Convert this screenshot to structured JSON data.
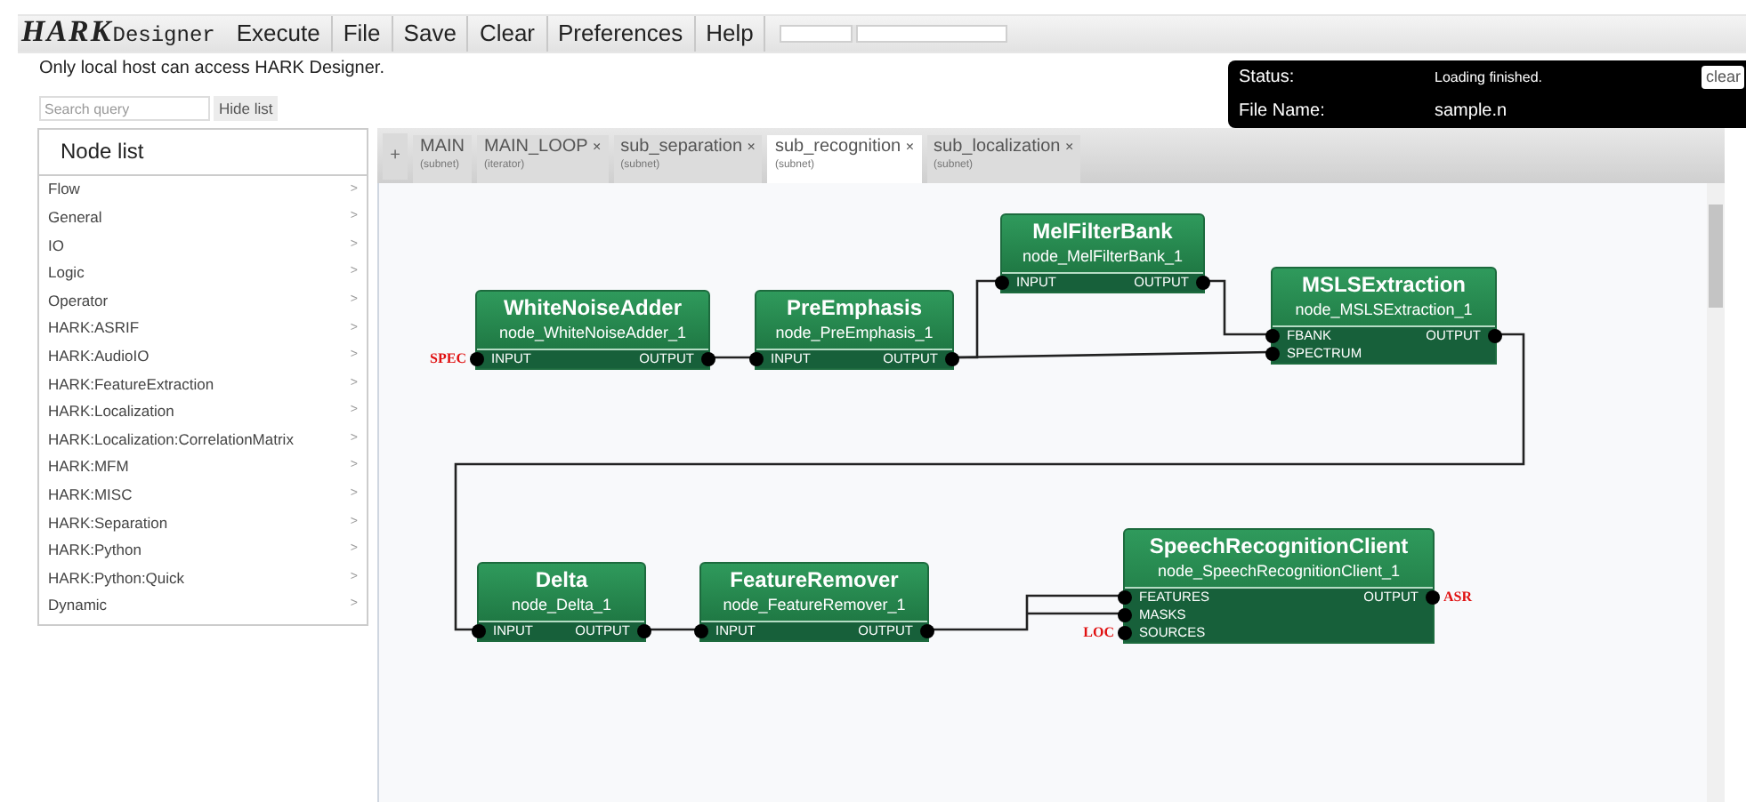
{
  "menu": {
    "logo": "HARK",
    "logo_suffix": "Designer",
    "items": [
      "Execute",
      "File",
      "Save",
      "Clear",
      "Preferences",
      "Help"
    ],
    "slider": {
      "level": 0.31
    }
  },
  "notice": "Only local host can access HARK Designer.",
  "status_panel": {
    "status_label": "Status:",
    "status": "Loading finished.",
    "clear": "clear",
    "file_label": "File Name:",
    "file": "sample.n"
  },
  "search": {
    "placeholder": "Search query",
    "hide_button": "Hide list"
  },
  "node_list": {
    "title": "Node list",
    "items": [
      {
        "label": "Flow",
        "arrow": ">"
      },
      {
        "label": "General",
        "arrow": ">"
      },
      {
        "label": "IO",
        "arrow": ">"
      },
      {
        "label": "Logic",
        "arrow": ">"
      },
      {
        "label": "Operator",
        "arrow": ">"
      },
      {
        "label": "HARK:ASRIF",
        "arrow": ">"
      },
      {
        "label": "HARK:AudioIO",
        "arrow": ">"
      },
      {
        "label": "HARK:FeatureExtraction",
        "arrow": ">"
      },
      {
        "label": "HARK:Localization",
        "arrow": ">"
      },
      {
        "label": "HARK:Localization:CorrelationMatrix",
        "arrow": ">"
      },
      {
        "label": "HARK:MFM",
        "arrow": ">"
      },
      {
        "label": "HARK:MISC",
        "arrow": ">"
      },
      {
        "label": "HARK:Separation",
        "arrow": ">"
      },
      {
        "label": "HARK:Python",
        "arrow": ">"
      },
      {
        "label": "HARK:Python:Quick",
        "arrow": ">"
      },
      {
        "label": "Dynamic",
        "arrow": ">"
      }
    ]
  },
  "tabs": {
    "add": "+",
    "items": [
      {
        "label": "MAIN",
        "sub": "(subnet)",
        "selected": false
      },
      {
        "label": "MAIN_LOOP",
        "sub": "(iterator)",
        "close": "×",
        "selected": false
      },
      {
        "label": "sub_separation",
        "sub": "(subnet)",
        "close": "×",
        "selected": false
      },
      {
        "label": "sub_recognition",
        "sub": "(subnet)",
        "close": "×",
        "selected": true
      },
      {
        "label": "sub_localization",
        "sub": "(subnet)",
        "close": "×",
        "selected": false
      }
    ]
  },
  "nodes": [
    {
      "title": "WhiteNoiseAdder",
      "id": "node_WhiteNoiseAdder_1",
      "inputs": [
        {
          "name": "INPUT",
          "terminal": "SPEC"
        }
      ],
      "outputs": [
        {
          "name": "OUTPUT"
        }
      ]
    },
    {
      "title": "PreEmphasis",
      "id": "node_PreEmphasis_1",
      "inputs": [
        {
          "name": "INPUT"
        }
      ],
      "outputs": [
        {
          "name": "OUTPUT"
        }
      ]
    },
    {
      "title": "MelFilterBank",
      "id": "node_MelFilterBank_1",
      "inputs": [
        {
          "name": "INPUT"
        }
      ],
      "outputs": [
        {
          "name": "OUTPUT"
        }
      ]
    },
    {
      "title": "MSLSExtraction",
      "id": "node_MSLSExtraction_1",
      "inputs": [
        {
          "name": "FBANK"
        },
        {
          "name": "SPECTRUM"
        }
      ],
      "outputs": [
        {
          "name": "OUTPUT"
        }
      ]
    },
    {
      "title": "Delta",
      "id": "node_Delta_1",
      "inputs": [
        {
          "name": "INPUT"
        }
      ],
      "outputs": [
        {
          "name": "OUTPUT"
        }
      ]
    },
    {
      "title": "FeatureRemover",
      "id": "node_FeatureRemover_1",
      "inputs": [
        {
          "name": "INPUT"
        }
      ],
      "outputs": [
        {
          "name": "OUTPUT"
        }
      ]
    },
    {
      "title": "SpeechRecognitionClient",
      "id": "node_SpeechRecognitionClient_1",
      "inputs": [
        {
          "name": "FEATURES"
        },
        {
          "name": "MASKS"
        },
        {
          "name": "SOURCES",
          "terminal": "LOC"
        }
      ],
      "outputs": [
        {
          "name": "OUTPUT",
          "terminal": "ASR"
        }
      ]
    }
  ]
}
